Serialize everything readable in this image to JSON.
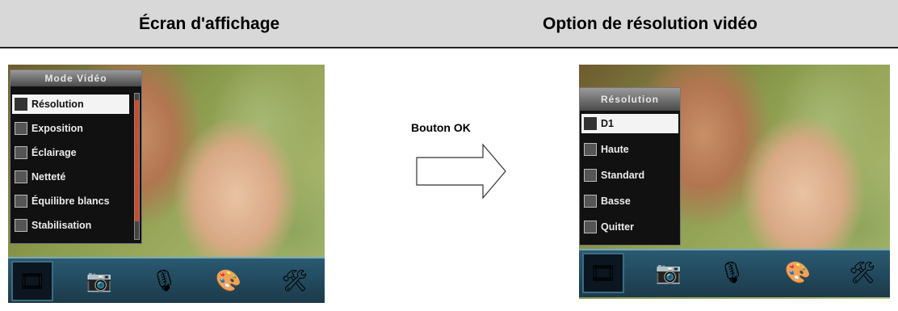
{
  "left": {
    "title": "Écran d'affichage",
    "menu": {
      "title": "Mode Vidéo",
      "items": [
        {
          "label": "Résolution",
          "selected": true
        },
        {
          "label": "Exposition",
          "selected": false
        },
        {
          "label": "Éclairage",
          "selected": false
        },
        {
          "label": "Netteté",
          "selected": false
        },
        {
          "label": "Équilibre blancs",
          "selected": false
        },
        {
          "label": "Stabilisation",
          "selected": false
        }
      ]
    }
  },
  "middle": {
    "arrow_label": "Bouton OK"
  },
  "right": {
    "title": "Option de résolution vidéo",
    "menu": {
      "title": "Résolution",
      "items": [
        {
          "label": "D1",
          "selected": true
        },
        {
          "label": "Haute",
          "selected": false
        },
        {
          "label": "Standard",
          "selected": false
        },
        {
          "label": "Basse",
          "selected": false
        },
        {
          "label": "Quitter",
          "selected": false
        }
      ]
    }
  },
  "bottom_tabs": [
    {
      "icon": "video-film-icon",
      "active": true
    },
    {
      "icon": "camera-icon",
      "active": false
    },
    {
      "icon": "microphone-icon",
      "active": false
    },
    {
      "icon": "palette-icon",
      "active": false
    },
    {
      "icon": "tools-icon",
      "active": false
    }
  ]
}
